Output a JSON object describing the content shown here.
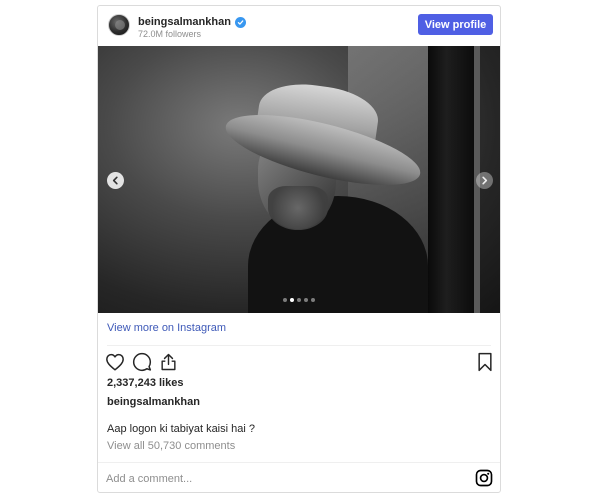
{
  "header": {
    "username": "beingsalmankhan",
    "followers": "72.0M followers",
    "view_profile_label": "View profile",
    "verified_icon": "verified-badge-icon",
    "accent": "#4f5fe4"
  },
  "media": {
    "carousel_total": 5,
    "carousel_active": 2,
    "prev_icon": "chevron-left-icon",
    "next_icon": "chevron-right-icon"
  },
  "view_more_label": "View more on Instagram",
  "actions": {
    "like_icon": "heart-icon",
    "comment_icon": "comment-icon",
    "share_icon": "share-icon",
    "save_icon": "bookmark-icon"
  },
  "likes": "2,337,243 likes",
  "caption": {
    "username": "beingsalmankhan",
    "text": "Aap logon ki tabiyat kaisi hai ?"
  },
  "comments_link": "View all 50,730 comments",
  "comment_bar": {
    "placeholder": "Add a comment...",
    "brand_icon": "instagram-icon"
  }
}
